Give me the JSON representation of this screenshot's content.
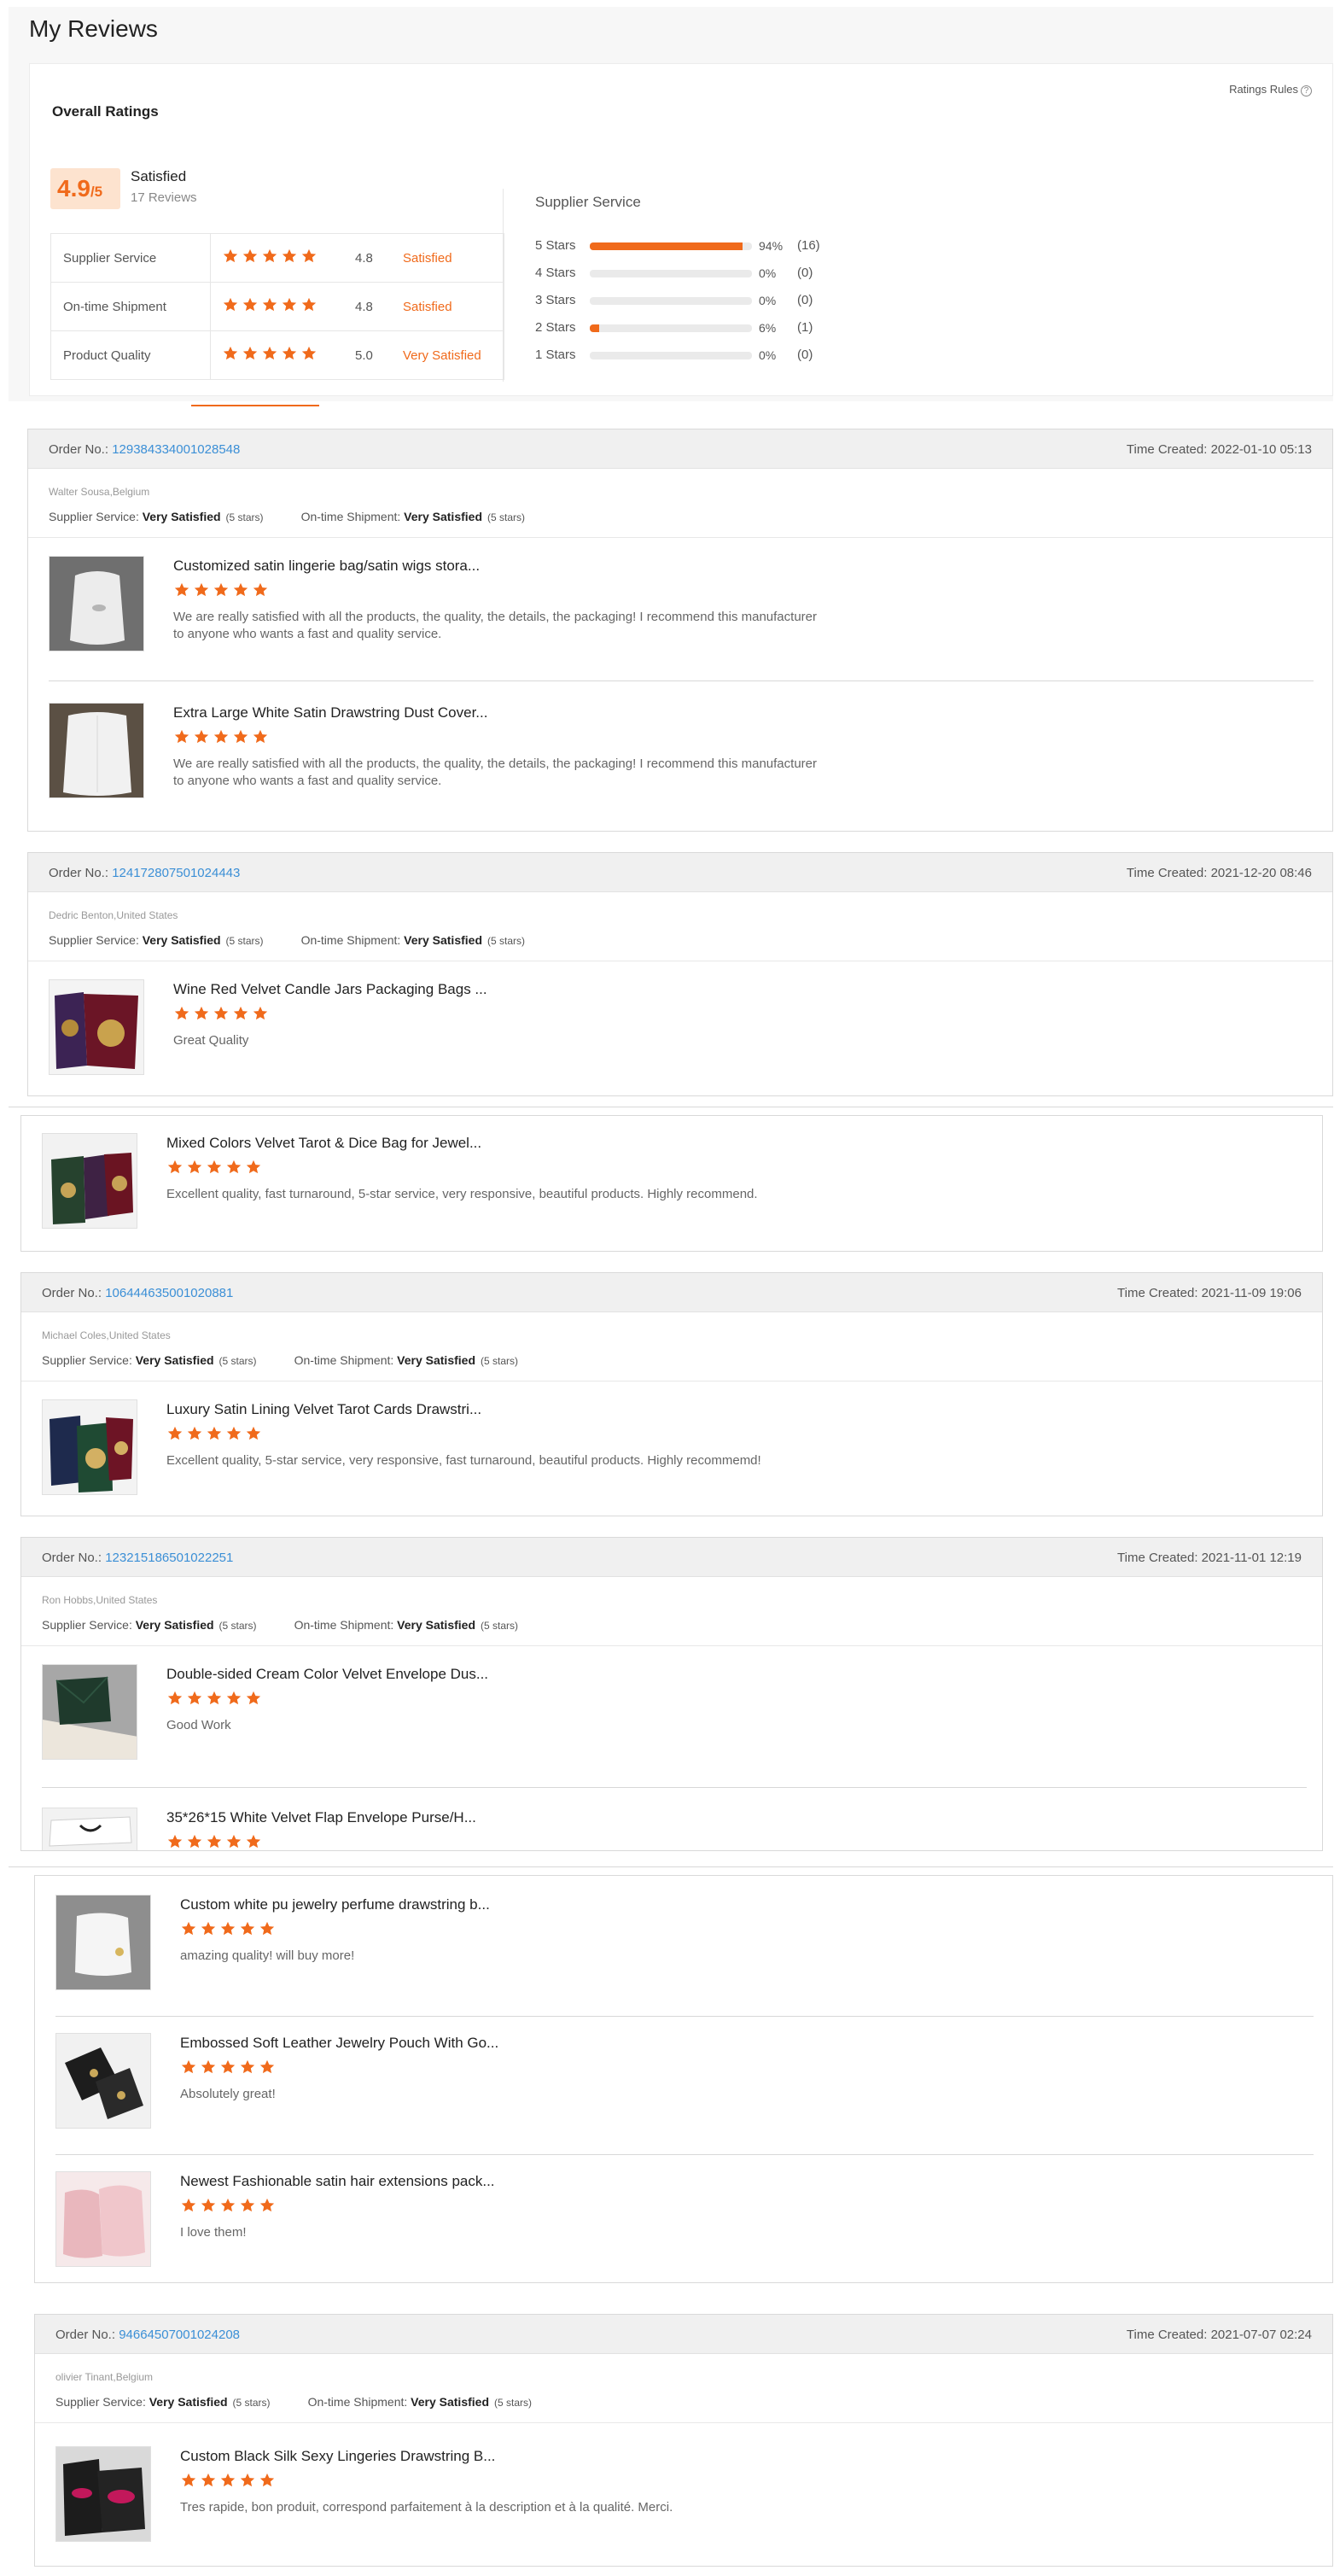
{
  "page": {
    "title": "My Reviews"
  },
  "overall": {
    "title": "Overall Ratings",
    "rules_label": "Ratings Rules",
    "score": "4.9",
    "score_of": "/5",
    "label": "Satisfied",
    "review_count": "17 Reviews",
    "metrics": [
      {
        "name": "Supplier Service",
        "stars": 5,
        "score": "4.8",
        "word": "Satisfied"
      },
      {
        "name": "On-time Shipment",
        "stars": 5,
        "score": "4.8",
        "word": "Satisfied"
      },
      {
        "name": "Product Quality",
        "stars": 5,
        "score": "5.0",
        "word": "Very Satisfied"
      }
    ]
  },
  "distribution": {
    "title": "Supplier Service",
    "rows": [
      {
        "label": "5 Stars",
        "percent": 94,
        "pct_text": "94%",
        "count": "(16)"
      },
      {
        "label": "4 Stars",
        "percent": 0,
        "pct_text": "0%",
        "count": "(0)"
      },
      {
        "label": "3 Stars",
        "percent": 0,
        "pct_text": "0%",
        "count": "(0)"
      },
      {
        "label": "2 Stars",
        "percent": 6,
        "pct_text": "6%",
        "count": "(1)"
      },
      {
        "label": "1 Stars",
        "percent": 0,
        "pct_text": "0%",
        "count": "(0)"
      }
    ]
  },
  "labels": {
    "order_no": "Order No.: ",
    "time_created": "Time Created: ",
    "supplier_service": "Supplier Service: ",
    "ontime_shipment": "On-time Shipment: ",
    "very_satisfied": "Very Satisfied",
    "five_stars": "(5 stars)"
  },
  "orders": [
    {
      "order_no": "129384334001028548",
      "time": "2022-01-10 05:13",
      "buyer": "Walter Sousa,Belgium",
      "items": [
        {
          "title": "Customized satin lingerie bag/satin wigs stora...",
          "stars": 5,
          "text": "We are really satisfied with all the products, the quality, the details, the packaging! I recommend this manufacturer to anyone who wants a fast and quality service."
        },
        {
          "title": "Extra Large White Satin Drawstring Dust Cover...",
          "stars": 5,
          "text": "We are really satisfied with all the products, the quality, the details, the packaging! I recommend this manufacturer to anyone who wants a fast and quality service."
        }
      ]
    },
    {
      "order_no": "124172807501024443",
      "time": "2021-12-20 08:46",
      "buyer": "Dedric Benton,United States",
      "items": [
        {
          "title": "Wine Red Velvet Candle Jars Packaging Bags ...",
          "stars": 5,
          "text": "Great Quality"
        }
      ]
    },
    {
      "items": [
        {
          "title": "Mixed Colors Velvet Tarot & Dice Bag for Jewel...",
          "stars": 5,
          "text": "Excellent quality, fast turnaround, 5-star service, very responsive, beautiful products. Highly recommend."
        }
      ]
    },
    {
      "order_no": "106444635001020881",
      "time": "2021-11-09 19:06",
      "buyer": "Michael Coles,United States",
      "items": [
        {
          "title": "Luxury Satin Lining Velvet Tarot Cards Drawstri...",
          "stars": 5,
          "text": "Excellent quality, 5-star service, very responsive, fast turnaround, beautiful products. Highly recommemd!"
        }
      ]
    },
    {
      "order_no": "123215186501022251",
      "time": "2021-11-01 12:19",
      "buyer": "Ron Hobbs,United States",
      "items": [
        {
          "title": "Double-sided Cream Color Velvet Envelope Dus...",
          "stars": 5,
          "text": "Good Work"
        },
        {
          "title": "35*26*15 White Velvet Flap Envelope Purse/H...",
          "stars": 5,
          "text": ""
        }
      ]
    },
    {
      "items": [
        {
          "title": "Custom white pu jewelry perfume drawstring b...",
          "stars": 5,
          "text": "amazing quality! will buy more!"
        },
        {
          "title": "Embossed Soft Leather Jewelry Pouch With Go...",
          "stars": 5,
          "text": "Absolutely great!"
        },
        {
          "title": "Newest Fashionable satin hair extensions pack...",
          "stars": 5,
          "text": "I love them!"
        }
      ]
    },
    {
      "order_no": "94664507001024208",
      "time": "2021-07-07 02:24",
      "buyer": "olivier Tinant,Belgium",
      "items": [
        {
          "title": "Custom Black Silk Sexy Lingeries Drawstring B...",
          "stars": 5,
          "text": "Tres rapide, bon produit, correspond parfaitement à la description et à la qualité. Merci."
        }
      ]
    }
  ],
  "colors": {
    "accent": "#f06a1b",
    "link": "#3b8fd6"
  },
  "icons": {
    "star": "star-icon",
    "help": "help-circle-icon"
  }
}
